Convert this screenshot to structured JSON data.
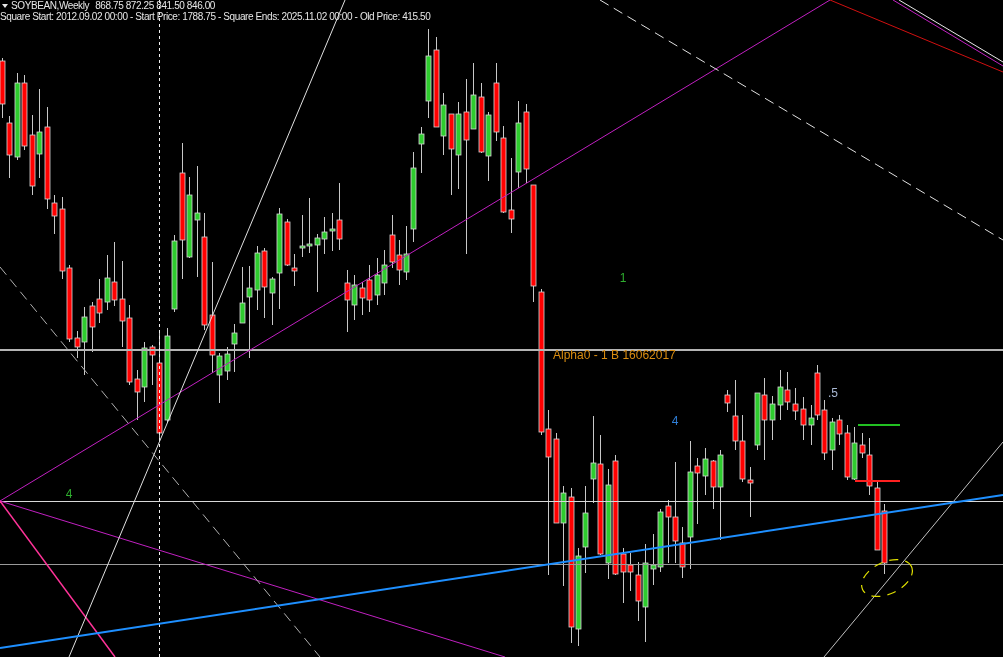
{
  "chart_header": {
    "symbol": "SOYBEAN,Weekly",
    "ohlc": "868.75 872.25 841.50 846.00",
    "info": "Square Start: 2012.09.02 00:00 - Start Price: 1788.75 - Square Ends: 2025.11.02 00:00 - Old Price: 415.50"
  },
  "chart_labels": [
    {
      "text": "1",
      "color": "#2eae2e"
    },
    {
      "text": "Alpha0 - 1 B 16062017",
      "color": "#d98c10"
    },
    {
      "text": ".5",
      "color": "#a9b8d4"
    },
    {
      "text": "4",
      "color": "#2f7fd8"
    },
    {
      "text": "4",
      "color": "#2eae2e"
    }
  ]
}
